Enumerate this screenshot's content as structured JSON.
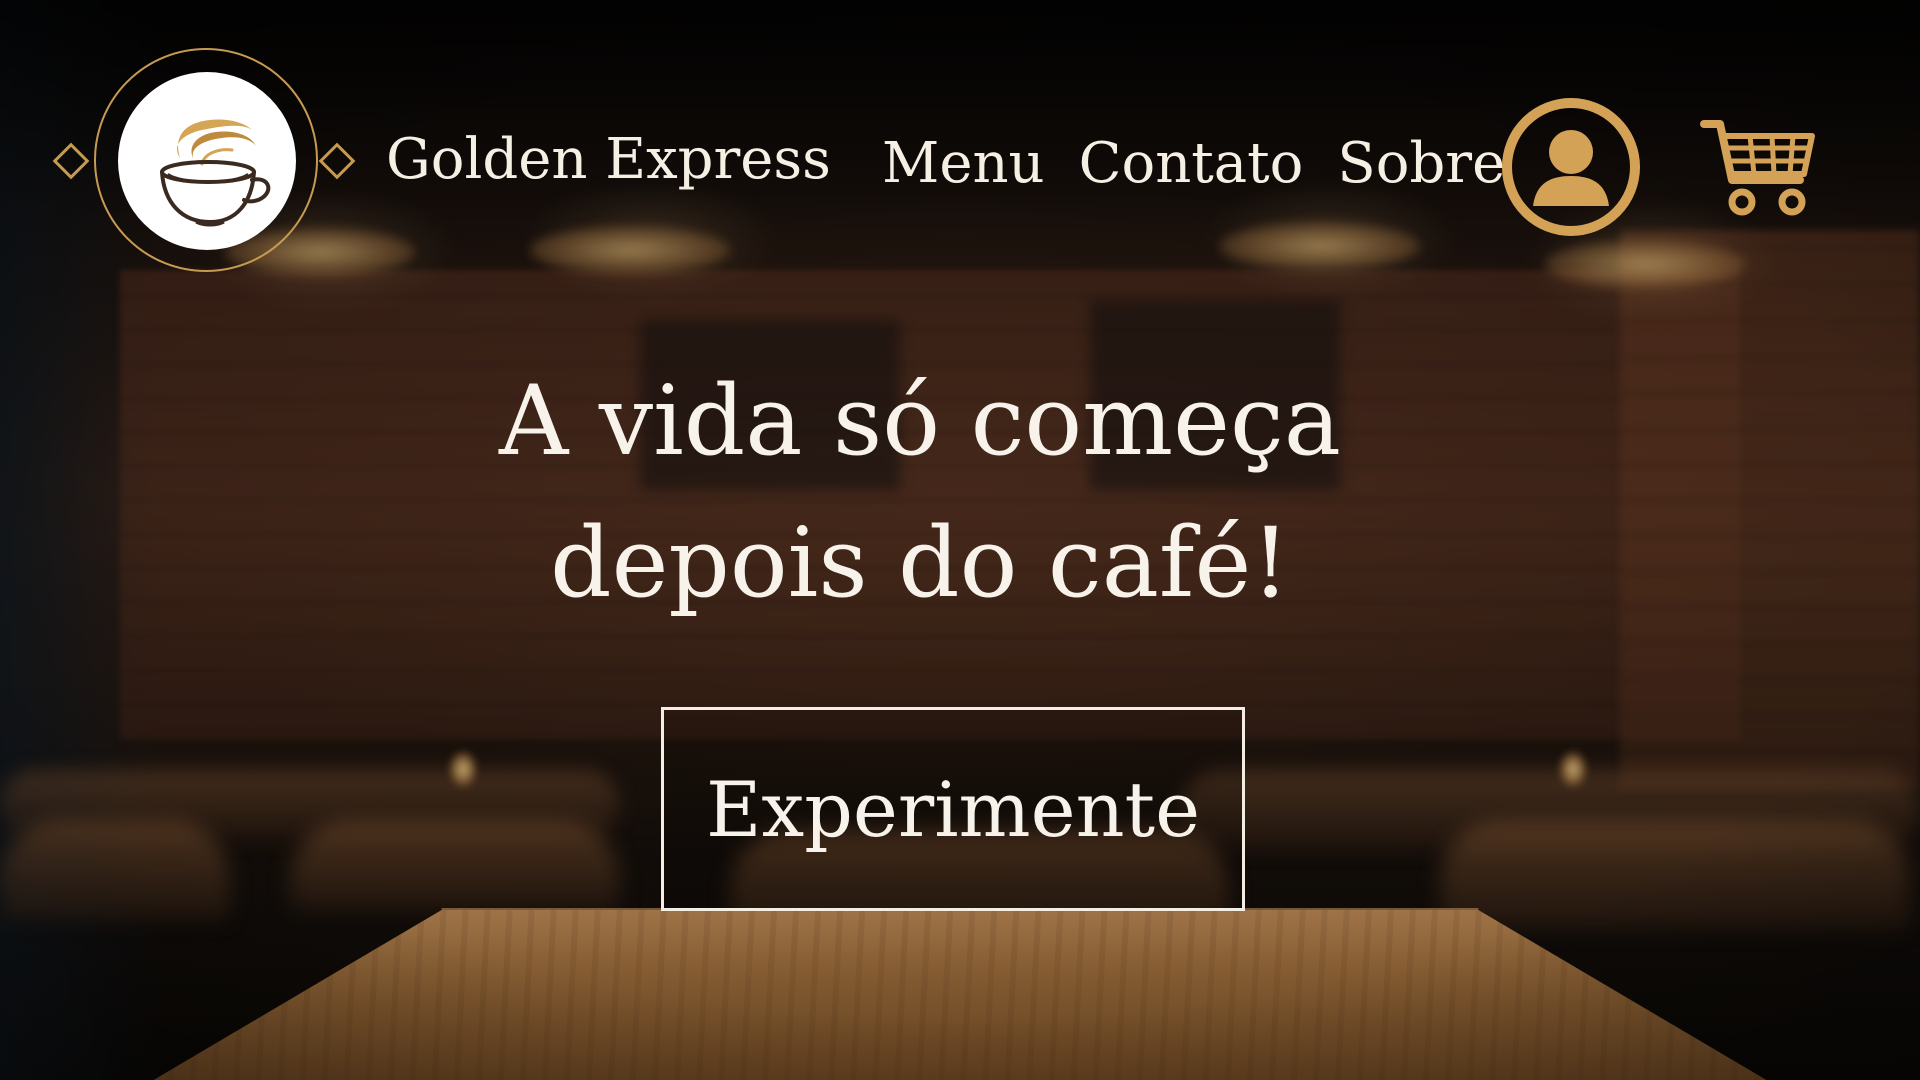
{
  "brand": {
    "name": "Golden Express",
    "logo_icon": "coffee-cup-icon"
  },
  "nav": {
    "items": [
      {
        "label": "Menu"
      },
      {
        "label": "Contato"
      },
      {
        "label": "Sobre"
      }
    ]
  },
  "header_actions": {
    "user_icon": "user-icon",
    "cart_icon": "shopping-cart-icon"
  },
  "hero": {
    "line1": "A vida só começa",
    "line2": "depois do café!",
    "cta_label": "Experimente"
  },
  "colors": {
    "accent_gold": "#D4A257",
    "text_light": "#F5EFE4",
    "cup_dark": "#3a2a20"
  }
}
